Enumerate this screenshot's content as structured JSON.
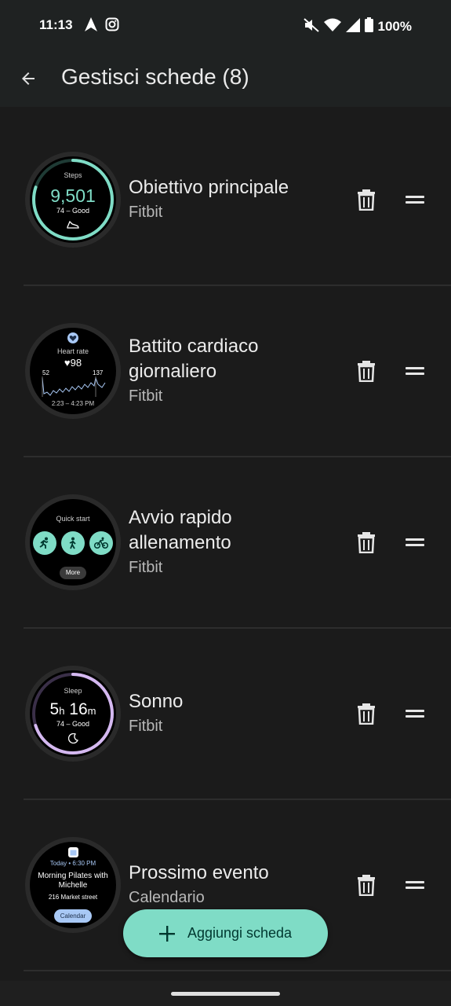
{
  "status_bar": {
    "time": "11:13",
    "battery": "100%",
    "icons": [
      "navigation-icon",
      "instagram-icon",
      "mute-icon",
      "wifi-icon",
      "signal-icon",
      "battery-icon"
    ]
  },
  "app_bar": {
    "title": "Gestisci schede (8)"
  },
  "tiles": [
    {
      "title": "Obiettivo principale",
      "subtitle": "Fitbit",
      "preview": {
        "label": "Steps",
        "value": "9,501",
        "detail": "74 – Good",
        "ring_color": "#7fdcc6",
        "ring_progress": 0.8
      }
    },
    {
      "title": "Battito cardiaco giornaliero",
      "subtitle": "Fitbit",
      "preview": {
        "label": "Heart rate",
        "value": "♥98",
        "low": "52",
        "high": "137",
        "range": "2:23 – 4:23 PM",
        "accent": "#a8c8f5"
      }
    },
    {
      "title": "Avvio rapido allenamento",
      "subtitle": "Fitbit",
      "preview": {
        "label": "Quick start",
        "more": "More",
        "accent": "#7fdcc6"
      }
    },
    {
      "title": "Sonno",
      "subtitle": "Fitbit",
      "preview": {
        "label": "Sleep",
        "hours": "5",
        "h_unit": "h",
        "minutes": "16",
        "m_unit": "m",
        "detail": "74 – Good",
        "ring_color": "#d4b8f0",
        "ring_progress": 0.7
      }
    },
    {
      "title": "Prossimo evento",
      "subtitle": "Calendario",
      "preview": {
        "when": "Today • 6:30 PM",
        "event": "Morning Pilates with Michelle",
        "place": "216 Market street",
        "chip": "Calendar",
        "accent": "#a8c8f5"
      }
    }
  ],
  "fab": {
    "label": "Aggiungi scheda"
  }
}
